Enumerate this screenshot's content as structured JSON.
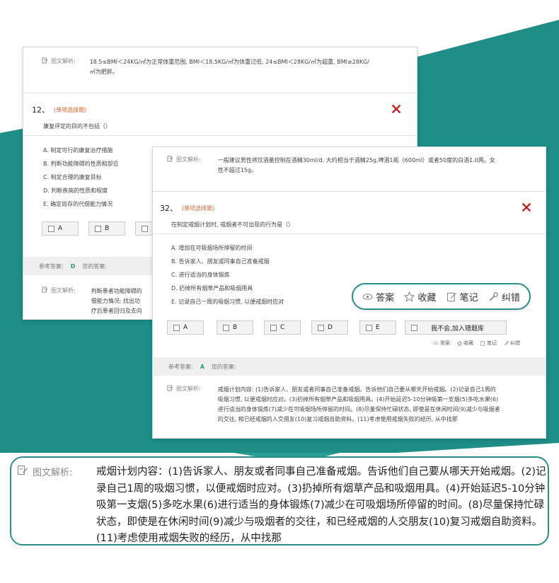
{
  "colors": {
    "teal": "#1e8e86",
    "orange": "#e0662a",
    "red_x": "#c0282d",
    "green_answer": "#2a9d6a"
  },
  "card1": {
    "top_explanation": {
      "label": "图文解析:",
      "text": "18.5≤BMI＜24KG/㎡为正常体重范围, BMI＜18.5KG/㎡为体重过低, 24≤BMI＜28KG/㎡为超重, BMI≥28KG/㎡为肥胖。"
    },
    "question": {
      "number": "12、",
      "type": "(单项选择题)",
      "stem": "康复评定的目的不包括（）",
      "options": [
        "A. 制定可行的康复治疗措施",
        "B. 判断功能障碍的性质和部位",
        "C. 制定合理的康复目标",
        "D. 判断疾病的性质和程度",
        "E. 确定尚存的代偿能力情况"
      ],
      "answer_boxes": [
        "A",
        "B"
      ]
    },
    "reference": {
      "label": "参考答案:",
      "answer": "D",
      "yours": "您的答案:"
    },
    "explanation": {
      "label": "图文解析:",
      "lines": [
        "判断患者功能障碍的",
        "偿能力情况; 找出功",
        "疗后患者回归及去向"
      ]
    }
  },
  "card2": {
    "top_explanation": {
      "label": "图文解析:",
      "text": "一般建议男性将饮酒量控制在酒精30ml/d, 大约相当于酒精25g,啤酒1瓶（600ml）或者50度的白酒1.0两。女性不超过15g。"
    },
    "question": {
      "number": "32、",
      "type": "(单项选择题)",
      "stem": "在制定戒烟计划时, 戒烟者不可出现的行为是（）",
      "options": [
        "A. 增加在可吸烟场所停留的时间",
        "B. 告诉家人、朋友或同事自己准备戒烟",
        "C. 进行适当的身体锻炼",
        "D. 扔掉所有烟草产品和吸烟用具",
        "E. 记录自己一周的吸烟习惯, 以便戒烟时应对"
      ],
      "answer_boxes": [
        "A",
        "B",
        "C",
        "D",
        "E"
      ],
      "unknown_button": "我不会,加入错题库"
    },
    "mini_tools": [
      "答案",
      "收藏",
      "笔记",
      "纠错"
    ],
    "reference": {
      "label": "参考答案:",
      "answer": "A",
      "yours": "您的答案:"
    },
    "explanation": {
      "label": "图文解析:",
      "text": "戒烟计划内容: (1)告诉家人、朋友或者同事自己准备戒烟。告诉他们自己要从哪天开始戒烟。(2)记录自己1周的吸烟习惯, 以便戒烟时应对。(3)扔掉所有烟草产品和吸烟用具。(4)开始延迟5-10分钟吸第一支烟(5)多吃水果(6)进行适当的身体锻炼(7)减少在可吸烟场所停留的时间。(8)尽量保持忙碌状态, 即使是在休闲时间(9)减少与吸烟者的交往, 和已经戒烟的人交朋友(10)复习戒烟自助资料。(11)考虑使用戒烟失败的经历, 从中找那"
    }
  },
  "toolbar": {
    "answer": "答案",
    "favorite": "收藏",
    "notes": "笔记",
    "correct": "纠错"
  },
  "zoom": {
    "label": "图文解析:",
    "text": "戒烟计划内容：(1)告诉家人、朋友或者同事自己准备戒烟。告诉他们自己要从哪天开始戒烟。(2)记录自己1周的吸烟习惯，以便戒烟时应对。(3)扔掉所有烟草产品和吸烟用具。(4)开始延迟5-10分钟吸第一支烟(5)多吃水果(6)进行适当的身体锻炼(7)减少在可吸烟场所停留的时间。(8)尽量保持忙碌状态，即使是在休闲时间(9)减少与吸烟者的交往，和已经戒烟的人交朋友(10)复习戒烟自助资料。(11)考虑使用戒烟失败的经历，从中找那"
  }
}
